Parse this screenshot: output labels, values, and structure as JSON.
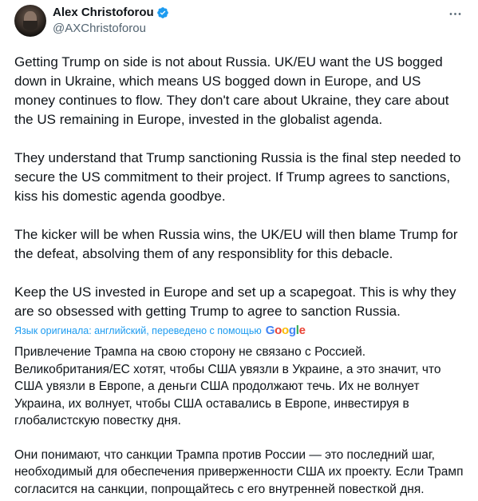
{
  "author": {
    "display_name": "Alex Christoforou",
    "handle": "@AXChristoforou"
  },
  "icons": {
    "verified": "verified-badge-icon",
    "more": "more-options-icon",
    "avatar": "avatar"
  },
  "colors": {
    "verified": "#1d9bf0",
    "link": "#1d9bf0",
    "text": "#0f1419",
    "secondary": "#536471"
  },
  "tweet": {
    "paragraphs": [
      "Getting Trump on side is not about Russia. UK/EU want the US bogged down in Ukraine, which means US bogged down in Europe, and US money continues to flow. They don't care about Ukraine, they care about the US remaining in Europe, invested in the globalist agenda.",
      "They understand that Trump sanctioning Russia is the final step needed to secure the US commitment to their project. If Trump agrees to sanctions, kiss his domestic agenda goodbye.",
      "The kicker will be when Russia wins, the UK/EU will then blame Trump for the defeat, absolving them of any responsiblity for this debacle.",
      "Keep the US invested in Europe and set up a scapegoat. This is why they are so obsessed with getting Trump to agree to sanction Russia."
    ]
  },
  "translation": {
    "note": "Язык оригинала: английский, переведено с помощью",
    "provider": "Google",
    "paragraphs": [
      "Привлечение Трампа на свою сторону не связано с Россией. Великобритания/ЕС хотят, чтобы США увязли в Украине, а это значит, что США увязли в Европе, а деньги США продолжают течь. Их не волнует Украина, их волнует, чтобы США оставались в Европе, инвестируя в глобалистскую повестку дня.",
      "Они понимают, что санкции Трампа против России — это последний шаг, необходимый для обеспечения приверженности США их проекту. Если Трамп согласится на санкции, попрощайтесь с его внутренней повесткой дня."
    ]
  }
}
